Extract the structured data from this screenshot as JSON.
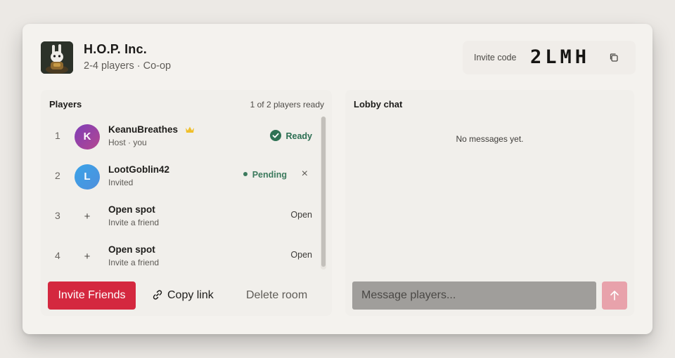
{
  "game": {
    "title": "H.O.P. Inc.",
    "meta": "2-4 players · Co-op",
    "art_icon": "bunny-robot-art"
  },
  "invite": {
    "label": "Invite code",
    "code": "2LMH",
    "copy_icon": "copy-icon"
  },
  "players_panel": {
    "title": "Players",
    "ready_count": "1 of 2 players ready",
    "rows": [
      {
        "slot": "1",
        "initial": "K",
        "name": "KeanuBreathes",
        "sub": "Host · you",
        "status": "Ready",
        "host": true
      },
      {
        "slot": "2",
        "initial": "L",
        "name": "LootGoblin42",
        "sub": "Invited",
        "status": "Pending",
        "remove": "×"
      },
      {
        "slot": "3",
        "plus": "+",
        "name": "Open spot",
        "sub": "Invite a friend",
        "status": "Open"
      },
      {
        "slot": "4",
        "plus": "+",
        "name": "Open spot",
        "sub": "Invite a friend",
        "status": "Open"
      }
    ]
  },
  "actions": {
    "invite_label": "Invite Friends",
    "copy_label": "Copy link",
    "delete_label": "Delete room"
  },
  "chat": {
    "title": "Lobby chat",
    "empty": "No messages yet.",
    "placeholder": "Message players..."
  },
  "colors": {
    "accent": "#d4283f",
    "ready": "#2e7254",
    "send_disabled": "#e8a2ab"
  }
}
